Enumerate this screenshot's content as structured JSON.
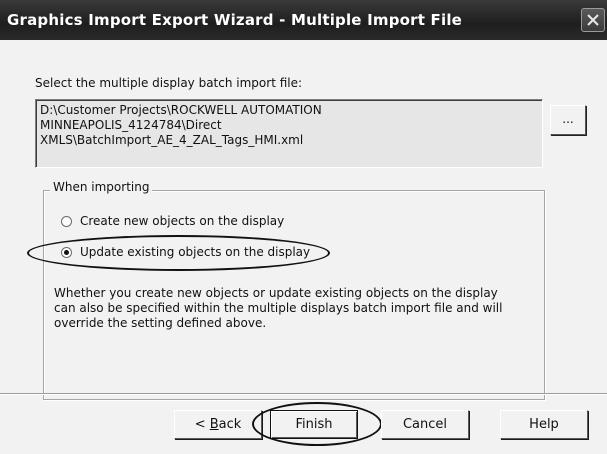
{
  "window": {
    "title": "Graphics Import Export Wizard - Multiple Import File"
  },
  "file_prompt": "Select the multiple display batch import file:",
  "file_path_lines": [
    "D:\\Customer Projects\\ROCKWELL AUTOMATION",
    "MINNEAPOLIS_4124784\\Direct",
    "XMLS\\BatchImport_AE_4_ZAL_Tags_HMI.xml"
  ],
  "browse_label": "...",
  "import_group": {
    "label": "When importing",
    "options": [
      {
        "label": "Create new objects on the display",
        "selected": false
      },
      {
        "label": "Update existing objects on the display",
        "selected": true
      }
    ],
    "description_lines": [
      "Whether you create new objects or update existing objects on the display",
      "can also be specified within the multiple displays batch import file and will",
      "override the setting defined above."
    ]
  },
  "buttons": {
    "back_prefix": "< ",
    "back_mnemonic": "B",
    "back_rest": "ack",
    "finish": "Finish",
    "cancel": "Cancel",
    "help": "Help"
  }
}
